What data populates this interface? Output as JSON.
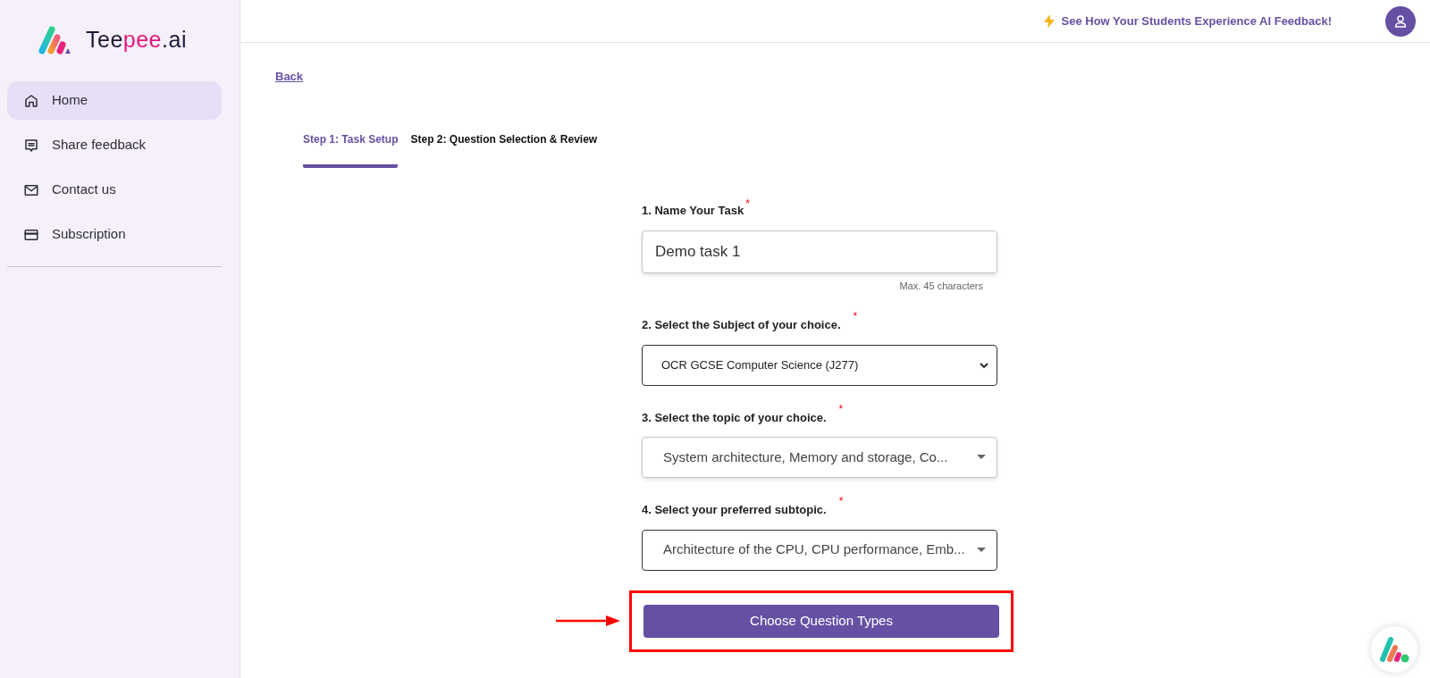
{
  "sidebar": {
    "logo_parts": [
      "Tee",
      "pee",
      ".ai"
    ],
    "items": [
      {
        "label": "Home",
        "kind": "home",
        "selected": true
      },
      {
        "label": "Share feedback",
        "kind": "feedback",
        "selected": false
      },
      {
        "label": "Contact us",
        "kind": "mail",
        "selected": false
      },
      {
        "label": "Subscription",
        "kind": "card",
        "selected": false
      }
    ]
  },
  "topbar": {
    "promo_link": "See How Your Students Experience AI Feedback!"
  },
  "back_link": "Back",
  "steps": [
    {
      "label": "Step 1: Task Setup",
      "selected": true
    },
    {
      "label": "Step 2: Question Selection & Review",
      "selected": false
    }
  ],
  "form": {
    "fields": [
      {
        "kind": "text",
        "label": "1. Name Your Task",
        "marker": "*",
        "value": "Demo task 1",
        "hint": "Max. 45 characters",
        "focused": false
      },
      {
        "kind": "native_select",
        "label": "2. Select the Subject of your choice.",
        "marker": "*",
        "value": "OCR GCSE Computer Science (J277)",
        "focused": true
      },
      {
        "kind": "autocomplete",
        "label": "3. Select the topic of your choice.",
        "marker": "*",
        "value": "System architecture, Memory and storage, Co...",
        "focused": false
      },
      {
        "kind": "autocomplete",
        "label": "4. Select your preferred subtopic.",
        "marker": "*",
        "value": "Architecture of the CPU, CPU performance, Emb...",
        "focused": true
      }
    ],
    "submit": "Choose Question Types"
  }
}
